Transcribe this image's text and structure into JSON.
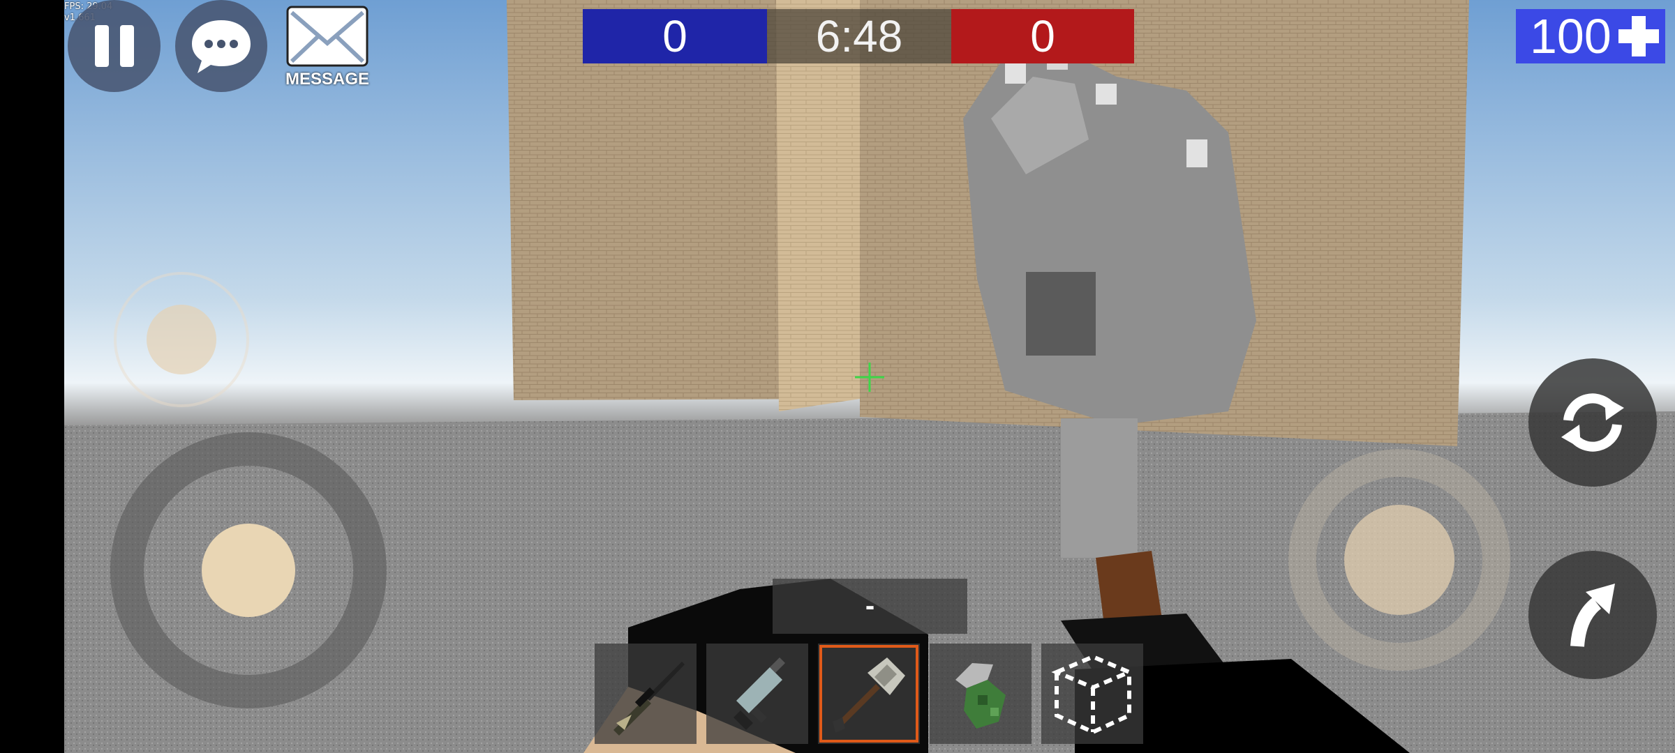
{
  "debug": {
    "fps": "FPS: 29.04",
    "version": "v1.661"
  },
  "top_left": {
    "pause_icon": "pause-icon",
    "chat_icon": "chat-bubble-icon",
    "message_icon": "envelope-icon",
    "message_label": "MESSAGE"
  },
  "scoreboard": {
    "blue_score": "0",
    "time": "6:48",
    "red_score": "0",
    "blue_color": "#1f25a8",
    "red_color": "#b3191b"
  },
  "health": {
    "value": "100",
    "icon": "plus-icon"
  },
  "weapon_status": {
    "ammo_text": "-"
  },
  "hotbar": {
    "selected_index": 2,
    "slots": [
      {
        "item": "sniper-rifle-icon"
      },
      {
        "item": "smg-icon"
      },
      {
        "item": "war-hammer-icon"
      },
      {
        "item": "grenade-icon"
      },
      {
        "item": "build-block-icon"
      }
    ]
  },
  "controls": {
    "reload_icon": "reload-icon",
    "jump_icon": "jump-arrow-icon"
  }
}
